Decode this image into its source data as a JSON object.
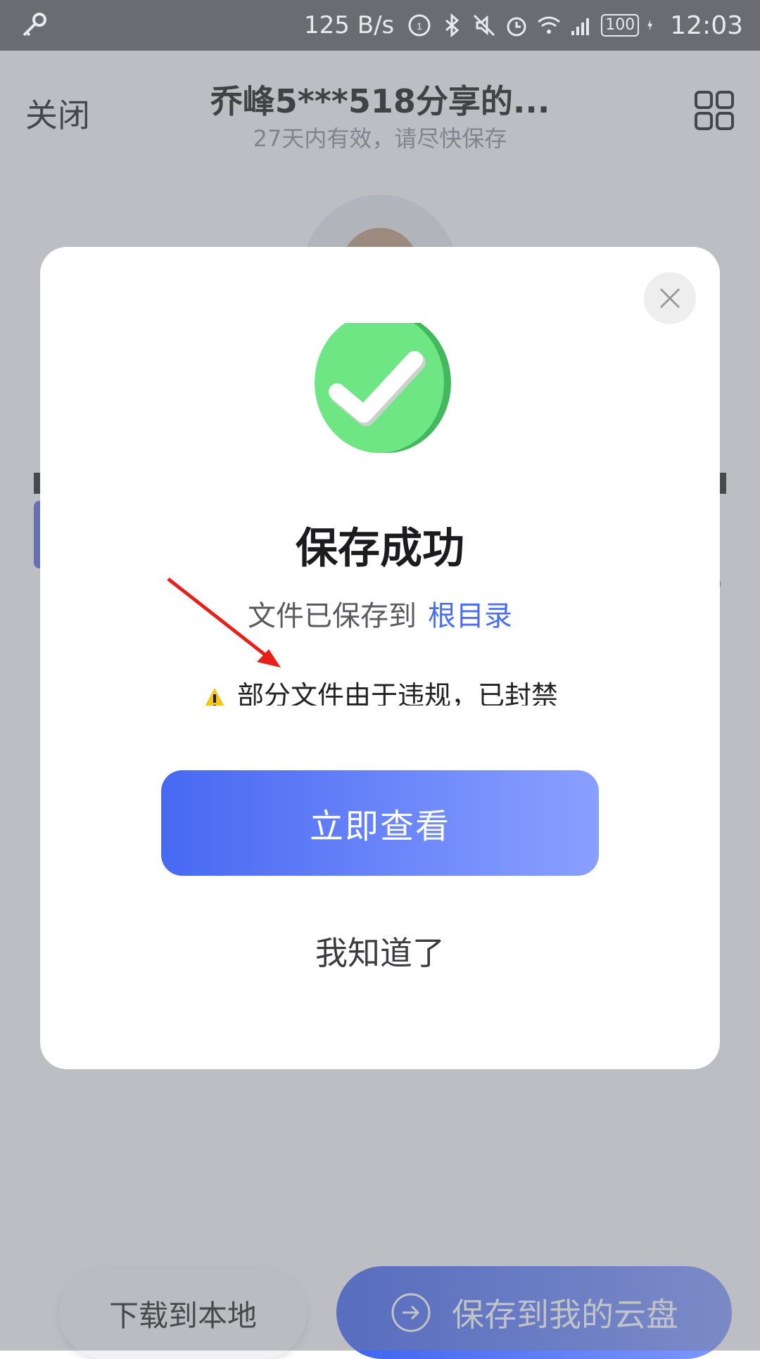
{
  "status_bar": {
    "speed": "125 B/s",
    "battery": "100",
    "time": "12:03",
    "icons": [
      "key-icon",
      "data-saver-icon",
      "bluetooth-icon",
      "mute-icon",
      "alarm-icon",
      "wifi-icon",
      "signal-4g-icon",
      "battery-icon",
      "charging-icon"
    ]
  },
  "header": {
    "close_label": "关闭",
    "title": "乔峰5***518分享的...",
    "subtitle": "27天内有效，请尽快保存",
    "menu_icon": "grid-icon"
  },
  "bottom": {
    "download_label": "下载到本地",
    "save_label": "保存到我的云盘"
  },
  "dialog": {
    "title": "保存成功",
    "path_prefix": "文件已保存到",
    "path_link": "根目录",
    "warning": "部分文件由于违规，已封禁",
    "primary_button": "立即查看",
    "secondary_button": "我知道了"
  },
  "colors": {
    "accent": "#4a6ef2",
    "success": "#5ee07a",
    "warning": "#f5c518",
    "annotation": "#e8201a"
  }
}
